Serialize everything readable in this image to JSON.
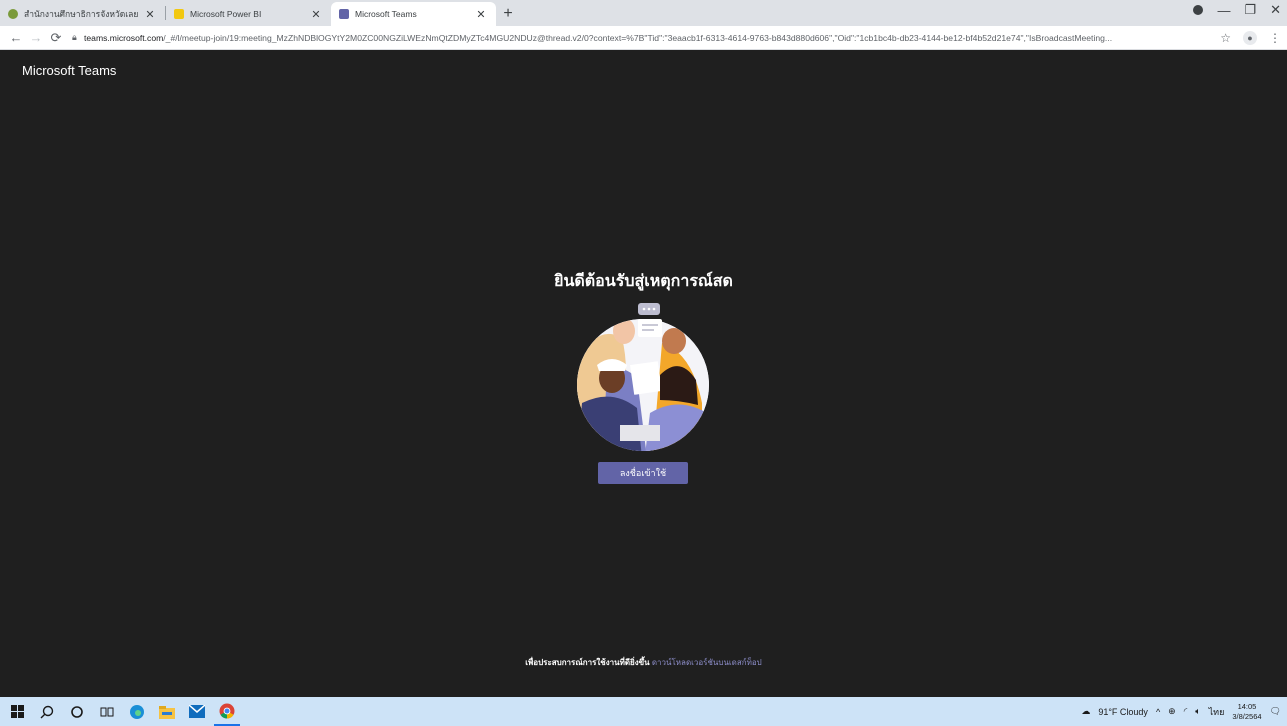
{
  "browser": {
    "tabs": [
      {
        "title": "สำนักงานศึกษาธิการจังหวัดเลย",
        "favicon_color": "#7a9a3a",
        "active": false
      },
      {
        "title": "Microsoft Power BI",
        "favicon_color": "#f2c811",
        "active": false
      },
      {
        "title": "Microsoft Teams",
        "favicon_color": "#6264a7",
        "active": true
      }
    ],
    "url_host": "teams.microsoft.com",
    "url_rest": "/_#/l/meetup-join/19:meeting_MzZhNDBlOGYtY2M0ZC00NGZiLWEzNmQtZDMyZTc4MGU2NDUz@thread.v2/0?context=%7B\"Tid\":\"3eaacb1f-6313-4614-9763-b843d880d606\",\"Oid\":\"1cb1bc4b-db23-4144-be12-bf4b52d21e74\",\"IsBroadcastMeeting...",
    "icons": [
      "back-icon",
      "forward-icon",
      "reload-icon",
      "lock-icon",
      "star-icon",
      "profile-icon",
      "menu-icon"
    ]
  },
  "app": {
    "brand": "Microsoft Teams",
    "welcome": "ยินดีต้อนรับสู่เหตุการณ์สด",
    "signin_label": "ลงชื่อเข้าใช้",
    "footer_text": "เพื่อประสบการณ์การใช้งานที่ดียิ่งขึ้น",
    "footer_link": "ดาวน์โหลดเวอร์ชันบนเดสก์ท็อป",
    "accent": "#6264a7"
  },
  "taskbar": {
    "weather": "91°F Cloudy",
    "lang": "ไทย",
    "time": "14:05",
    "date": "3/8/2564"
  }
}
